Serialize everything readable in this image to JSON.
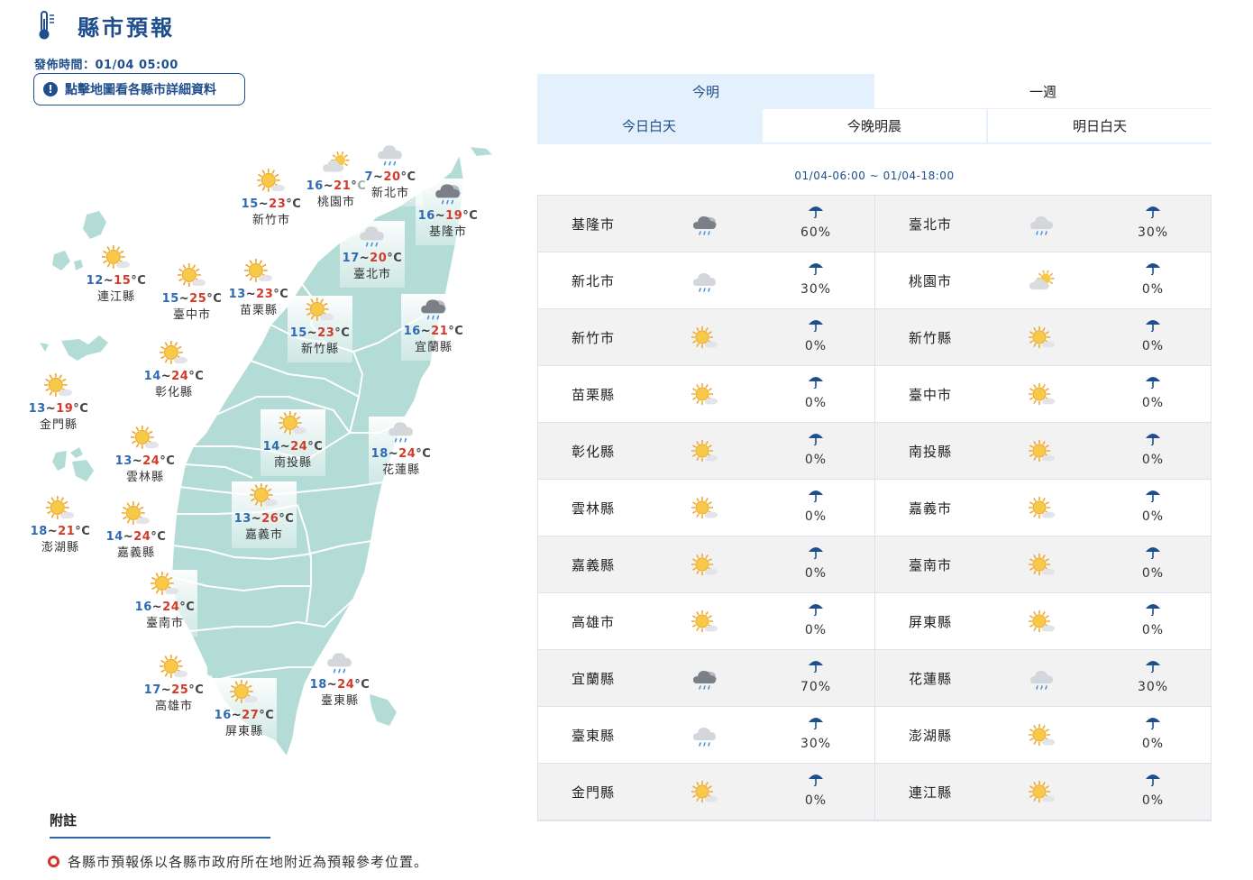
{
  "header": {
    "title": "縣市預報",
    "published": "發佈時間：01/04 05:00",
    "hint": "點擊地圖看各縣市詳細資料"
  },
  "tabs": [
    {
      "label": "今明",
      "active": true
    },
    {
      "label": "一週",
      "active": false
    }
  ],
  "subtabs": [
    {
      "label": "今日白天",
      "active": true
    },
    {
      "label": "今晚明晨",
      "active": false
    },
    {
      "label": "明日白天",
      "active": false
    }
  ],
  "period": "01/04-06:00 ~ 01/04-18:00",
  "map_markers": [
    {
      "name": "新竹市",
      "lo": "15",
      "hi": "23",
      "icon": "sunny"
    },
    {
      "name": "桃園市",
      "lo": "16",
      "hi": "21",
      "icon": "partly-cloudy"
    },
    {
      "name": "新北市",
      "lo": "7",
      "hi": "20",
      "icon": "cloudy-rain"
    },
    {
      "name": "基隆市",
      "lo": "16",
      "hi": "19",
      "icon": "dark-rain"
    },
    {
      "name": "連江縣",
      "lo": "12",
      "hi": "15",
      "icon": "sunny"
    },
    {
      "name": "臺中市",
      "lo": "15",
      "hi": "25",
      "icon": "sunny"
    },
    {
      "name": "苗栗縣",
      "lo": "13",
      "hi": "23",
      "icon": "sunny"
    },
    {
      "name": "臺北市",
      "lo": "17",
      "hi": "20",
      "icon": "cloudy-rain"
    },
    {
      "name": "新竹縣",
      "lo": "15",
      "hi": "23",
      "icon": "sunny"
    },
    {
      "name": "宜蘭縣",
      "lo": "16",
      "hi": "21",
      "icon": "dark-rain"
    },
    {
      "name": "彰化縣",
      "lo": "14",
      "hi": "24",
      "icon": "sunny"
    },
    {
      "name": "金門縣",
      "lo": "13",
      "hi": "19",
      "icon": "sunny"
    },
    {
      "name": "南投縣",
      "lo": "14",
      "hi": "24",
      "icon": "sunny"
    },
    {
      "name": "花蓮縣",
      "lo": "18",
      "hi": "24",
      "icon": "cloudy-rain"
    },
    {
      "name": "雲林縣",
      "lo": "13",
      "hi": "24",
      "icon": "sunny"
    },
    {
      "name": "嘉義市",
      "lo": "13",
      "hi": "26",
      "icon": "sunny"
    },
    {
      "name": "澎湖縣",
      "lo": "18",
      "hi": "21",
      "icon": "sunny"
    },
    {
      "name": "嘉義縣",
      "lo": "14",
      "hi": "24",
      "icon": "sunny"
    },
    {
      "name": "臺南市",
      "lo": "16",
      "hi": "24",
      "icon": "sunny"
    },
    {
      "name": "臺東縣",
      "lo": "18",
      "hi": "24",
      "icon": "cloudy-rain"
    },
    {
      "name": "高雄市",
      "lo": "17",
      "hi": "25",
      "icon": "sunny"
    },
    {
      "name": "屏東縣",
      "lo": "16",
      "hi": "27",
      "icon": "sunny"
    }
  ],
  "table": [
    {
      "name": "基隆市",
      "icon": "dark-rain",
      "rain": "60%"
    },
    {
      "name": "臺北市",
      "icon": "light-rain",
      "rain": "30%"
    },
    {
      "name": "新北市",
      "icon": "light-rain",
      "rain": "30%"
    },
    {
      "name": "桃園市",
      "icon": "partly-cloudy",
      "rain": "0%"
    },
    {
      "name": "新竹市",
      "icon": "sunny",
      "rain": "0%"
    },
    {
      "name": "新竹縣",
      "icon": "sunny",
      "rain": "0%"
    },
    {
      "name": "苗栗縣",
      "icon": "sunny",
      "rain": "0%"
    },
    {
      "name": "臺中市",
      "icon": "sunny",
      "rain": "0%"
    },
    {
      "name": "彰化縣",
      "icon": "sunny",
      "rain": "0%"
    },
    {
      "name": "南投縣",
      "icon": "sunny",
      "rain": "0%"
    },
    {
      "name": "雲林縣",
      "icon": "sunny",
      "rain": "0%"
    },
    {
      "name": "嘉義市",
      "icon": "sunny",
      "rain": "0%"
    },
    {
      "name": "嘉義縣",
      "icon": "sunny",
      "rain": "0%"
    },
    {
      "name": "臺南市",
      "icon": "sunny",
      "rain": "0%"
    },
    {
      "name": "高雄市",
      "icon": "sunny",
      "rain": "0%"
    },
    {
      "name": "屏東縣",
      "icon": "sunny",
      "rain": "0%"
    },
    {
      "name": "宜蘭縣",
      "icon": "dark-rain",
      "rain": "70%"
    },
    {
      "name": "花蓮縣",
      "icon": "light-rain",
      "rain": "30%"
    },
    {
      "name": "臺東縣",
      "icon": "light-rain",
      "rain": "30%"
    },
    {
      "name": "澎湖縣",
      "icon": "sunny",
      "rain": "0%"
    },
    {
      "name": "金門縣",
      "icon": "sunny",
      "rain": "0%"
    },
    {
      "name": "連江縣",
      "icon": "sunny",
      "rain": "0%"
    }
  ],
  "notes": {
    "title": "附註",
    "items": [
      "各縣市預報係以各縣市政府所在地附近為預報參考位置。"
    ]
  },
  "colors": {
    "brand": "#1f4e8c",
    "low_temp": "#2f6ab3",
    "high_temp": "#d43a2a",
    "land": "#b4dcd6",
    "tab_active": "#e4f0fb"
  }
}
